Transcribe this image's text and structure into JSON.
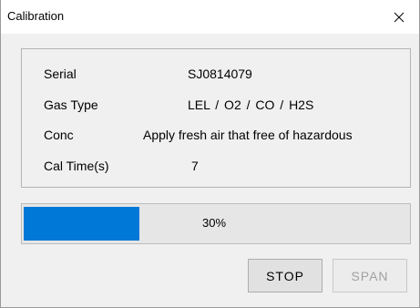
{
  "window": {
    "title": "Calibration",
    "close_icon": "close-icon"
  },
  "info": {
    "serial_label": "Serial",
    "serial_value": "SJ0814079",
    "gas_type_label": "Gas Type",
    "gas_type_value": "LEL / O2  / CO  / H2S",
    "conc_label": "Conc",
    "conc_value": "Apply fresh air that free of hazardous",
    "cal_time_label": "Cal Time(s)",
    "cal_time_value": "7"
  },
  "progress": {
    "percent": 30,
    "label": "30%",
    "fill_color": "#0078d7"
  },
  "buttons": {
    "stop_label": "STOP",
    "span_label": "SPAN",
    "span_enabled": false
  }
}
